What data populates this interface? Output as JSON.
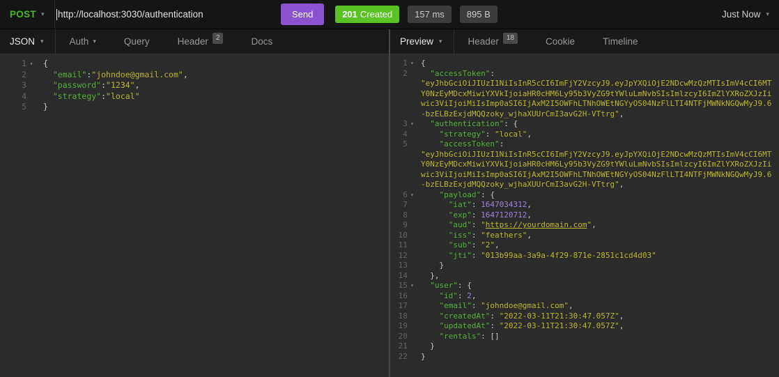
{
  "colors": {
    "method_green": "#47b821",
    "status_green": "#58c322",
    "send_purple": "#8b53d0",
    "key_green": "#55b13a",
    "string_olive": "#bcb62e",
    "number_purple": "#a281e0"
  },
  "icons": {
    "caret_down": "▾",
    "fold_open": "▾"
  },
  "topbar": {
    "method": "POST",
    "url": "http://localhost:3030/authentication",
    "send_label": "Send",
    "status_code": "201",
    "status_text": "Created",
    "time": "157 ms",
    "size": "895 B",
    "history": "Just Now"
  },
  "request_pane": {
    "body_type": "JSON",
    "tabs": [
      {
        "label": "Auth",
        "dropdown": true
      },
      {
        "label": "Query"
      },
      {
        "label": "Header",
        "badge": "2"
      },
      {
        "label": "Docs"
      }
    ],
    "lines": [
      {
        "fold": true,
        "parts": [
          [
            "punc",
            "{"
          ]
        ]
      },
      {
        "parts": [
          [
            "punc",
            "  "
          ],
          [
            "key",
            "\"email\""
          ],
          [
            "punc",
            ":"
          ],
          [
            "str",
            "\"johndoe@gmail.com\""
          ],
          [
            "punc",
            ","
          ]
        ]
      },
      {
        "parts": [
          [
            "punc",
            "  "
          ],
          [
            "key",
            "\"password\""
          ],
          [
            "punc",
            ":"
          ],
          [
            "str",
            "\"1234\""
          ],
          [
            "punc",
            ","
          ]
        ]
      },
      {
        "parts": [
          [
            "punc",
            "  "
          ],
          [
            "key",
            "\"strategy\""
          ],
          [
            "punc",
            ":"
          ],
          [
            "str",
            "\"local\""
          ]
        ]
      },
      {
        "parts": [
          [
            "punc",
            "}"
          ]
        ]
      }
    ]
  },
  "response_pane": {
    "view": "Preview",
    "tabs": [
      {
        "label": "Header",
        "badge": "18"
      },
      {
        "label": "Cookie"
      },
      {
        "label": "Timeline"
      }
    ],
    "lines": [
      {
        "fold": true,
        "parts": [
          [
            "punc",
            "{"
          ]
        ]
      },
      {
        "parts": [
          [
            "punc",
            "  "
          ],
          [
            "key",
            "\"accessToken\""
          ],
          [
            "punc",
            ": "
          ],
          [
            "str",
            "\"eyJhbGciOiJIUzI1NiIsInR5cCI6ImFjY2VzcyJ9.eyJpYXQiOjE2NDcwMzQzMTIsImV4cCI6MTY0NzEyMDcxMiwiYXVkIjoiaHR0cHM6Ly95b3VyZG9tYWluLmNvbSIsImlzcyI6ImZlYXRoZXJzIiwic3ViIjoiMiIsImp0aSI6IjAxM2I5OWFhLTNhOWEtNGYyOS04NzFlLTI4NTFjMWNkNGQwMyJ9.6-bzELBzExjdMQQzoky_wjhaXUUrCmI3avG2H-VTtrg\""
          ],
          [
            "punc",
            ","
          ]
        ]
      },
      {
        "fold": true,
        "parts": [
          [
            "punc",
            "  "
          ],
          [
            "key",
            "\"authentication\""
          ],
          [
            "punc",
            ": {"
          ]
        ]
      },
      {
        "parts": [
          [
            "punc",
            "    "
          ],
          [
            "key",
            "\"strategy\""
          ],
          [
            "punc",
            ": "
          ],
          [
            "str",
            "\"local\""
          ],
          [
            "punc",
            ","
          ]
        ]
      },
      {
        "parts": [
          [
            "punc",
            "    "
          ],
          [
            "key",
            "\"accessToken\""
          ],
          [
            "punc",
            ": "
          ],
          [
            "str",
            "\"eyJhbGciOiJIUzI1NiIsInR5cCI6ImFjY2VzcyJ9.eyJpYXQiOjE2NDcwMzQzMTIsImV4cCI6MTY0NzEyMDcxMiwiYXVkIjoiaHR0cHM6Ly95b3VyZG9tYWluLmNvbSIsImlzcyI6ImZlYXRoZXJzIiwic3ViIjoiMiIsImp0aSI6IjAxM2I5OWFhLTNhOWEtNGYyOS04NzFlLTI4NTFjMWNkNGQwMyJ9.6-bzELBzExjdMQQzoky_wjhaXUUrCmI3avG2H-VTtrg\""
          ],
          [
            "punc",
            ","
          ]
        ]
      },
      {
        "fold": true,
        "parts": [
          [
            "punc",
            "    "
          ],
          [
            "key",
            "\"payload\""
          ],
          [
            "punc",
            ": {"
          ]
        ]
      },
      {
        "parts": [
          [
            "punc",
            "      "
          ],
          [
            "key",
            "\"iat\""
          ],
          [
            "punc",
            ": "
          ],
          [
            "num",
            "1647034312"
          ],
          [
            "punc",
            ","
          ]
        ]
      },
      {
        "parts": [
          [
            "punc",
            "      "
          ],
          [
            "key",
            "\"exp\""
          ],
          [
            "punc",
            ": "
          ],
          [
            "num",
            "1647120712"
          ],
          [
            "punc",
            ","
          ]
        ]
      },
      {
        "parts": [
          [
            "punc",
            "      "
          ],
          [
            "key",
            "\"aud\""
          ],
          [
            "punc",
            ": "
          ],
          [
            "str",
            "\""
          ],
          [
            "link",
            "https://yourdomain.com"
          ],
          [
            "str",
            "\""
          ],
          [
            "punc",
            ","
          ]
        ]
      },
      {
        "parts": [
          [
            "punc",
            "      "
          ],
          [
            "key",
            "\"iss\""
          ],
          [
            "punc",
            ": "
          ],
          [
            "str",
            "\"feathers\""
          ],
          [
            "punc",
            ","
          ]
        ]
      },
      {
        "parts": [
          [
            "punc",
            "      "
          ],
          [
            "key",
            "\"sub\""
          ],
          [
            "punc",
            ": "
          ],
          [
            "str",
            "\"2\""
          ],
          [
            "punc",
            ","
          ]
        ]
      },
      {
        "parts": [
          [
            "punc",
            "      "
          ],
          [
            "key",
            "\"jti\""
          ],
          [
            "punc",
            ": "
          ],
          [
            "str",
            "\"013b99aa-3a9a-4f29-871e-2851c1cd4d03\""
          ]
        ]
      },
      {
        "parts": [
          [
            "punc",
            "    }"
          ]
        ]
      },
      {
        "parts": [
          [
            "punc",
            "  },"
          ]
        ]
      },
      {
        "fold": true,
        "parts": [
          [
            "punc",
            "  "
          ],
          [
            "key",
            "\"user\""
          ],
          [
            "punc",
            ": {"
          ]
        ]
      },
      {
        "parts": [
          [
            "punc",
            "    "
          ],
          [
            "key",
            "\"id\""
          ],
          [
            "punc",
            ": "
          ],
          [
            "num",
            "2"
          ],
          [
            "punc",
            ","
          ]
        ]
      },
      {
        "parts": [
          [
            "punc",
            "    "
          ],
          [
            "key",
            "\"email\""
          ],
          [
            "punc",
            ": "
          ],
          [
            "str",
            "\"johndoe@gmail.com\""
          ],
          [
            "punc",
            ","
          ]
        ]
      },
      {
        "parts": [
          [
            "punc",
            "    "
          ],
          [
            "key",
            "\"createdAt\""
          ],
          [
            "punc",
            ": "
          ],
          [
            "str",
            "\"2022-03-11T21:30:47.057Z\""
          ],
          [
            "punc",
            ","
          ]
        ]
      },
      {
        "parts": [
          [
            "punc",
            "    "
          ],
          [
            "key",
            "\"updatedAt\""
          ],
          [
            "punc",
            ": "
          ],
          [
            "str",
            "\"2022-03-11T21:30:47.057Z\""
          ],
          [
            "punc",
            ","
          ]
        ]
      },
      {
        "parts": [
          [
            "punc",
            "    "
          ],
          [
            "key",
            "\"rentals\""
          ],
          [
            "punc",
            ": []"
          ]
        ]
      },
      {
        "parts": [
          [
            "punc",
            "  }"
          ]
        ]
      },
      {
        "parts": [
          [
            "punc",
            "}"
          ]
        ]
      }
    ]
  }
}
